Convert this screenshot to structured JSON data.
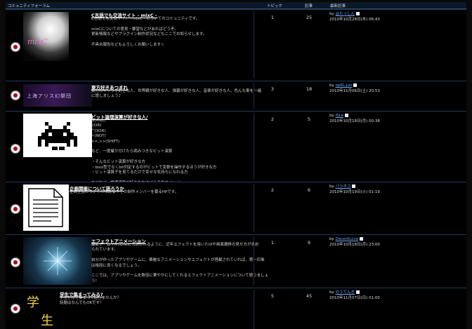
{
  "header": {
    "title": "コミュニティフォーラム",
    "col_topics": "トピック",
    "col_posts": "記事",
    "col_latest": "最新記事"
  },
  "rows": [
    {
      "title": "C言語でも交流サイト - mixC -",
      "desc": "C言語でも交流サイト - mixC - についてのコミュニティです。\n\nmixCについての意見・要望などがあればどうぞ。\n更新情報などやプラグイン制作状況などもここでお知らせします。\n\n不具合報告などもよろしくお願いします☆",
      "topics": "1",
      "posts": "25",
      "by": "by",
      "user": "@たっしん",
      "date": "2010年10月28日(木) 06:43",
      "thumb_text": "mixC"
    },
    {
      "title": "東方好きあつまれ",
      "desc": "東方のキャラが好きな人、世界観が好きな人、弾幕が好きな人、音楽が好きな人、色んな東を一緒\nに語しましょう♪",
      "topics": "3",
      "posts": "18",
      "by": "by",
      "user": "opKL.Jun",
      "date": "2010年11月06日(土) 20:53",
      "thumb_text": "上海アリス幻樂団"
    },
    {
      "title": "ビット論理演算が好きな人/",
      "desc": "&(AND)\n|(OR)\n^(XOR)\n~(NOT)\n<<,>>(SHIFT)\n\nなど、一度撮り付けたら病みつきなビット演算\n\n・そんなビット演算が好きな方\n・bool型でなくbit列定するのがビットで変数を操作するほうが好きな方\n・ビット演算子を見てるだけで幸せな気持ちになれる方\n\nなどなど、論理演算が好きな方はどうぞですイ(ー`)",
      "topics": "2",
      "posts": "5",
      "by": "by",
      "user": "ISLe",
      "date": "2010年10月18日(月) 00:38"
    },
    {
      "title": "企画開催について語ろうか",
      "desc": "企画全般についての相談事やその制作メンバーを募るHPです。",
      "topics": "2",
      "posts": "6",
      "by": "by",
      "user": "バラネコ",
      "date": "2010年10月19日(火) 01:19"
    },
    {
      "title": "エフェクトアニメーション",
      "desc": "最新ゲームやiPhoneに代表されるように、近年エフェクトを用いたUIや画面遷移の見せ方が求め\nられています。\n\n自分が作ったアプリやゲームに、華麗なアニメーションやエフェクトが搭載されていれば、第一印象\nは格段に良くなるでしょう。\n\nここでは、アプリやゲームを数倍に華やかにしてくれるエフェクトアニメーションについて語りましょ\nう！",
      "topics": "1",
      "posts": "9",
      "by": "by",
      "user": "DecentLove",
      "date": "2010年10月18日(月) 23:00"
    },
    {
      "title": "学生で集まってみる?",
      "desc": "学生さんで集まって話しませんか？\n話題はなんでもOKです！",
      "topics": "5",
      "posts": "45",
      "by": "by",
      "user": "のうてんき",
      "date": "2010年11月07日(日) 01:00",
      "thumb_text_1": "学",
      "thumb_text_2": "生"
    }
  ]
}
